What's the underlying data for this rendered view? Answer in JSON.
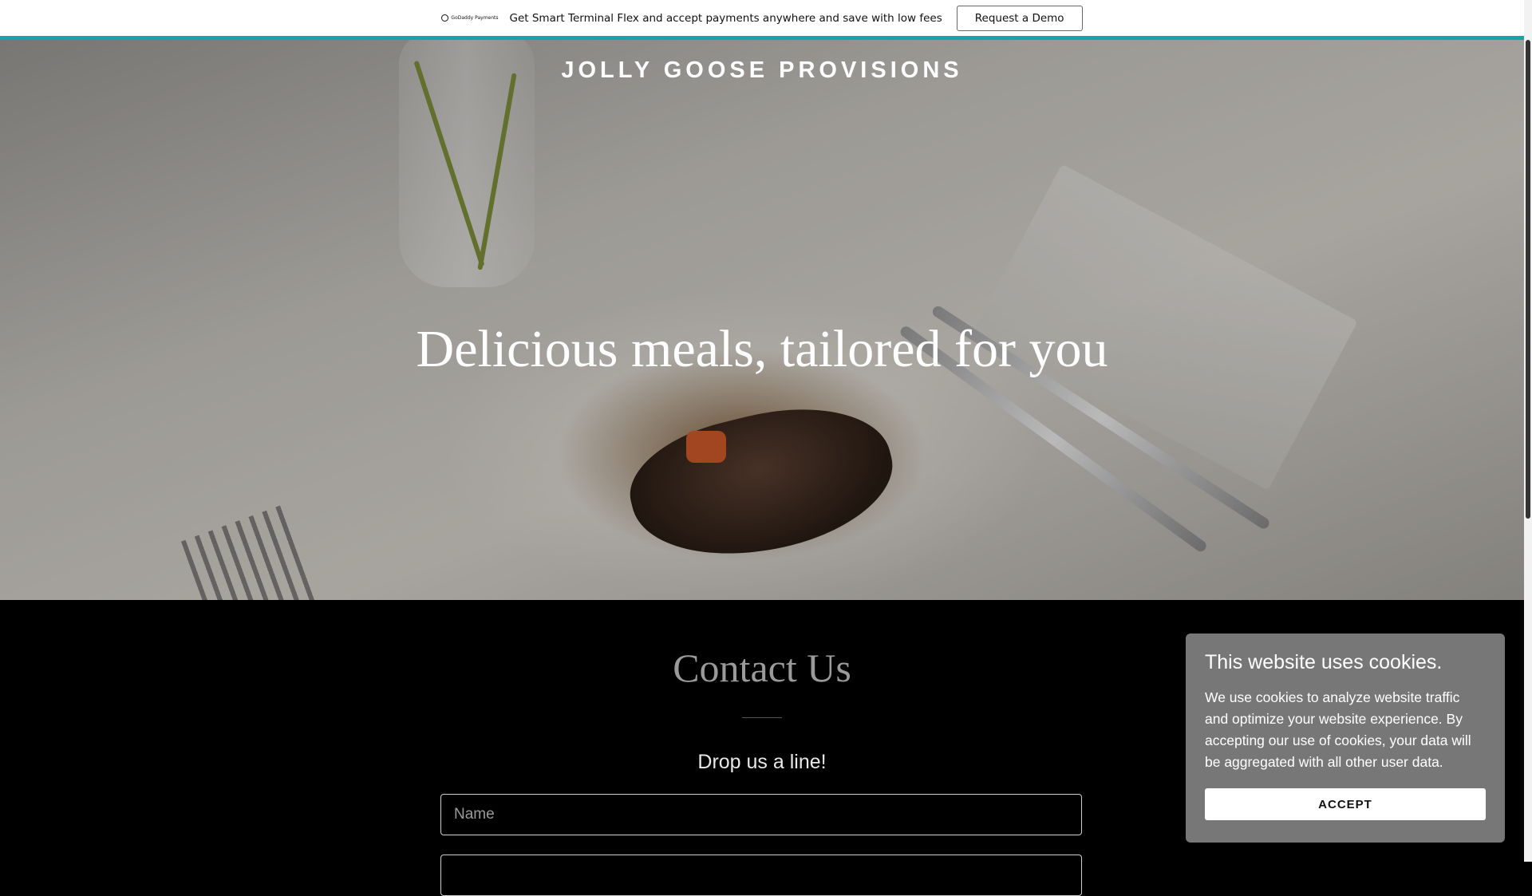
{
  "promo_bar": {
    "brand_text": "GoDaddy Payments",
    "message": "Get Smart Terminal Flex and accept payments anywhere and save with low fees",
    "cta_label": "Request a Demo",
    "accent_color": "#1ba3a3"
  },
  "hero": {
    "site_title": "JOLLY GOOSE PROVISIONS",
    "tagline": "Delicious meals, tailored for you"
  },
  "contact": {
    "title": "Contact Us",
    "subtitle": "Drop us a line!",
    "fields": [
      {
        "placeholder": "Name",
        "value": ""
      },
      {
        "placeholder": "",
        "value": ""
      }
    ]
  },
  "cookie_banner": {
    "title": "This website uses cookies.",
    "body": "We use cookies to analyze website traffic and optimize your website experience. By accepting our use of cookies, your data will be aggregated with all other user data.",
    "accept_label": "ACCEPT"
  }
}
